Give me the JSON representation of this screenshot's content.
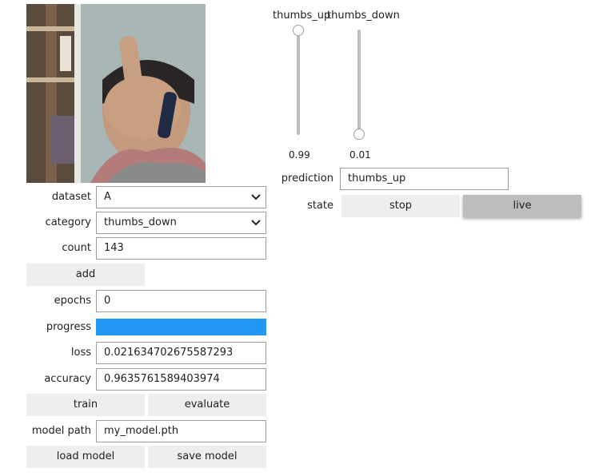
{
  "camera": {
    "icon": "camera-preview"
  },
  "form": {
    "dataset": {
      "label": "dataset",
      "value": "A"
    },
    "category": {
      "label": "category",
      "value": "thumbs_down"
    },
    "count": {
      "label": "count",
      "value": "143"
    },
    "add_label": "add",
    "epochs": {
      "label": "epochs",
      "value": "0"
    },
    "progress": {
      "label": "progress",
      "value": 1.0,
      "color": "#2196f3"
    },
    "loss": {
      "label": "loss",
      "value": "0.021634702675587293"
    },
    "accuracy": {
      "label": "accuracy",
      "value": "0.9635761589403974"
    },
    "train_label": "train",
    "evaluate_label": "evaluate",
    "model_path": {
      "label": "model path",
      "value": "my_model.pth"
    },
    "load_model_label": "load model",
    "save_model_label": "save model"
  },
  "sliders": {
    "thumbs_up": {
      "label": "thumbs_up",
      "value": 0.99,
      "display": "0.99"
    },
    "thumbs_down": {
      "label": "thumbs_down",
      "value": 0.01,
      "display": "0.01"
    }
  },
  "live": {
    "prediction_label": "prediction",
    "prediction_value": "thumbs_up",
    "state_label": "state",
    "stop_label": "stop",
    "live_label": "live",
    "active_state": "live"
  }
}
